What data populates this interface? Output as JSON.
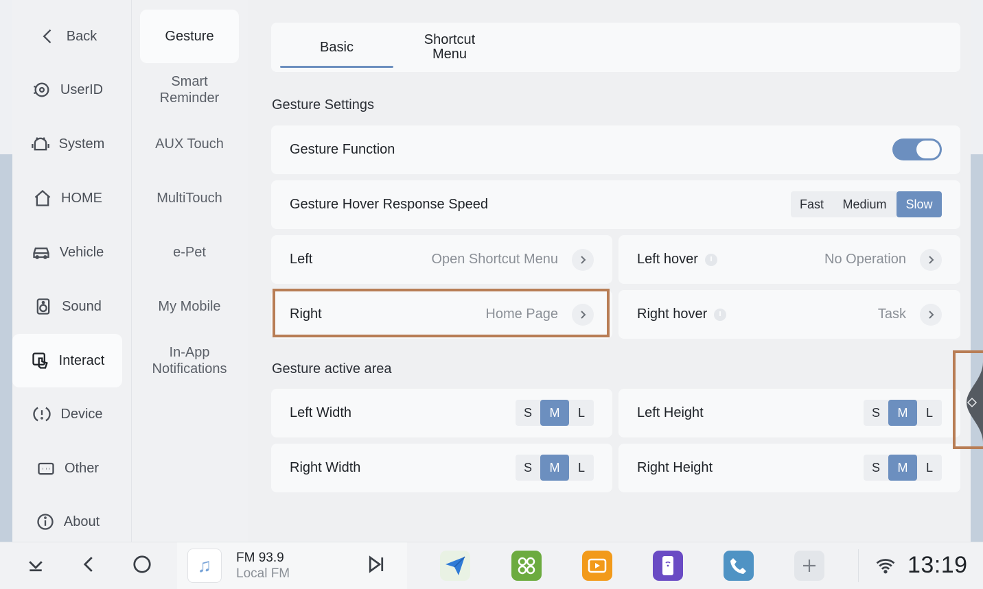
{
  "sidebar": {
    "items": [
      {
        "label": "Back",
        "icon": "chevron-left-icon"
      },
      {
        "label": "UserID",
        "icon": "user-id-icon"
      },
      {
        "label": "System",
        "icon": "android-icon"
      },
      {
        "label": "HOME",
        "icon": "home-icon"
      },
      {
        "label": "Vehicle",
        "icon": "car-icon"
      },
      {
        "label": "Sound",
        "icon": "speaker-icon"
      },
      {
        "label": "Interact",
        "icon": "touch-icon",
        "active": true
      },
      {
        "label": "Device",
        "icon": "device-alert-icon"
      },
      {
        "label": "Other",
        "icon": "more-icon"
      },
      {
        "label": "About",
        "icon": "info-icon"
      }
    ]
  },
  "submenu": {
    "items": [
      "Gesture",
      "Smart Reminder",
      "AUX Touch",
      "MultiTouch",
      "e-Pet",
      "My Mobile",
      "In-App Notifications"
    ],
    "active": "Gesture"
  },
  "tabs": {
    "basic": "Basic",
    "shortcut_menu": "Shortcut Menu",
    "active": "Basic"
  },
  "gesture_settings": {
    "title": "Gesture Settings",
    "gesture_function": {
      "label": "Gesture Function",
      "enabled": true
    },
    "hover_speed": {
      "label": "Gesture Hover Response Speed",
      "options": [
        "Fast",
        "Medium",
        "Slow"
      ],
      "selected": "Slow"
    },
    "left": {
      "label": "Left",
      "value": "Open Shortcut Menu"
    },
    "left_hover": {
      "label": "Left hover",
      "value": "No Operation"
    },
    "right": {
      "label": "Right",
      "value": "Home Page"
    },
    "right_hover": {
      "label": "Right hover",
      "value": "Task"
    }
  },
  "active_area": {
    "title": "Gesture active area",
    "options": [
      "S",
      "M",
      "L"
    ],
    "left_width": {
      "label": "Left Width",
      "selected": "M"
    },
    "left_height": {
      "label": "Left Height",
      "selected": "M"
    },
    "right_width": {
      "label": "Right Width",
      "selected": "M"
    },
    "right_height": {
      "label": "Right Height",
      "selected": "M"
    }
  },
  "dock": {
    "media_title": "FM 93.9",
    "media_subtitle": "Local FM",
    "clock": "13:19",
    "apps": [
      "navigation-app",
      "apps-grid-app",
      "video-app",
      "phone-mirror-app",
      "phone-app",
      "add-app"
    ]
  },
  "colors": {
    "accent": "#6c8fbf",
    "highlight": "#b87d55",
    "panel": "#f8f9fa",
    "background": "#eff0f2"
  }
}
